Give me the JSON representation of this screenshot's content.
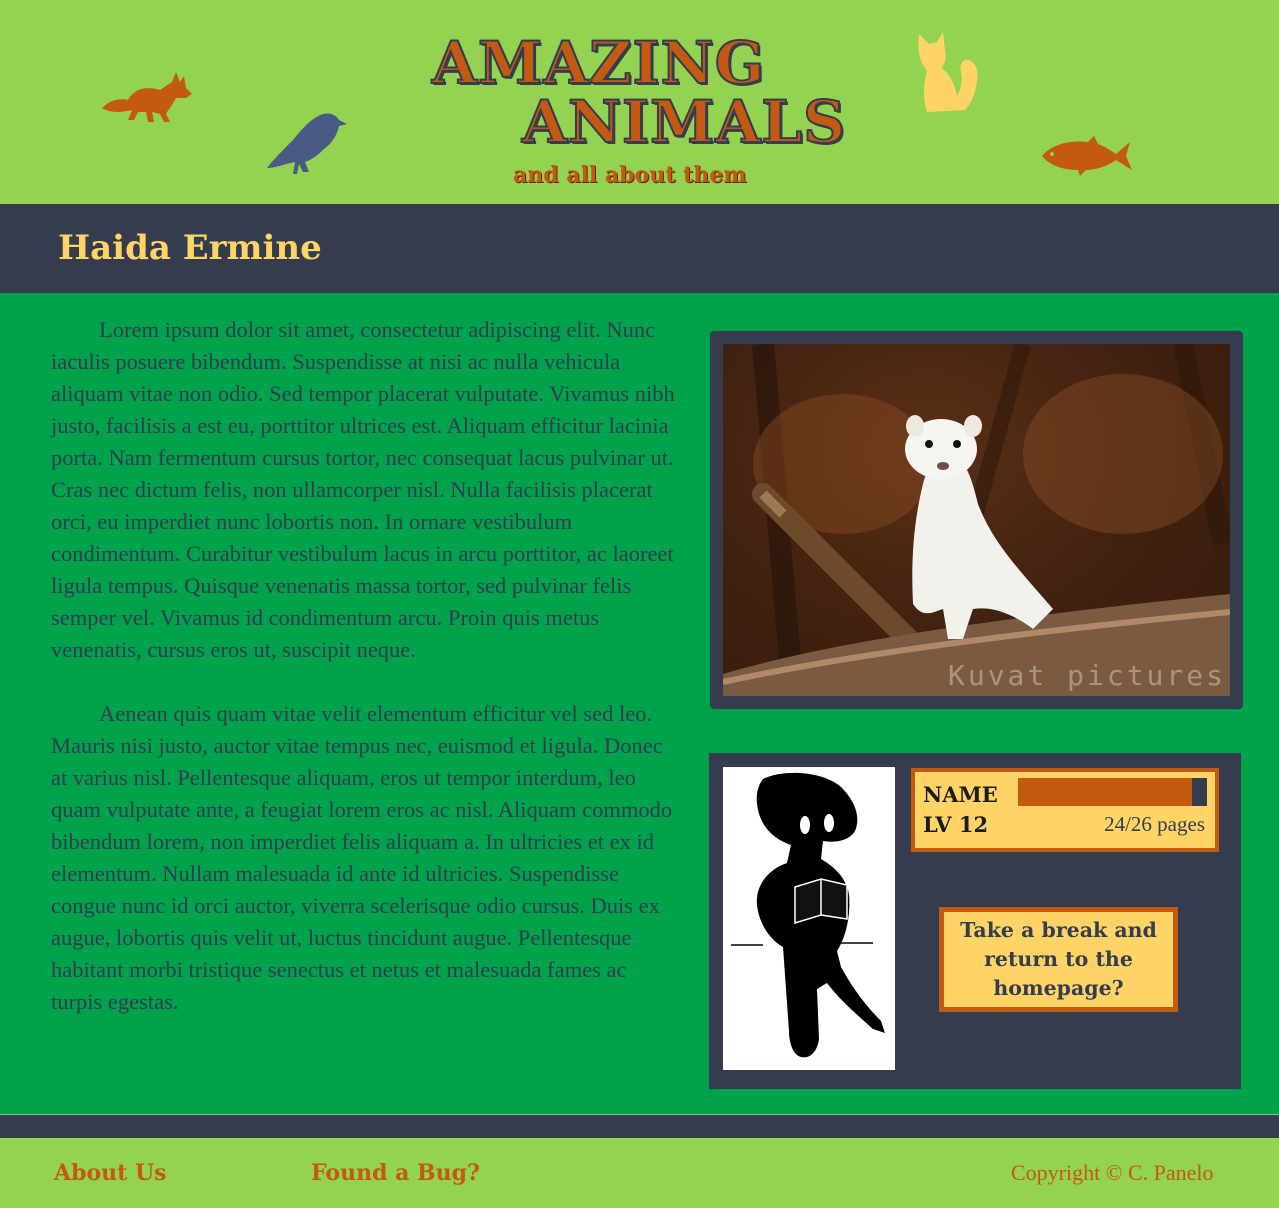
{
  "header": {
    "logo_line1": "AMAZING",
    "logo_line2": "ANIMALS",
    "tagline": "and all about them"
  },
  "icons": {
    "fox": "fox-icon",
    "bird": "bird-icon",
    "cat": "cat-icon",
    "fish": "fish-icon"
  },
  "page": {
    "title": "Haida Ermine"
  },
  "article": {
    "paragraphs": [
      "Lorem ipsum dolor sit amet, consectetur adipiscing elit. Nunc iaculis posuere bibendum. Suspendisse at nisi ac nulla vehicula aliquam vitae non odio. Sed tempor placerat vulputate. Vivamus nibh justo, facilisis a est eu, porttitor ultrices est. Aliquam efficitur lacinia porta. Nam fermentum cursus tortor, nec consequat lacus pulvinar ut. Cras nec dictum felis, non ullamcorper nisl. Nulla facilisis placerat orci, eu imperdiet nunc lobortis non. In ornare vestibulum condimentum. Curabitur vestibulum lacus in arcu porttitor, ac laoreet ligula tempus. Quisque venenatis massa tortor, sed pulvinar felis semper vel. Vivamus id condimentum arcu. Proin quis metus venenatis, cursus eros ut, suscipit neque.",
      "Aenean quis quam vitae velit elementum efficitur vel sed leo. Mauris nisi justo, auctor vitae tempus nec, euismod et ligula. Donec at varius nisl. Pellentesque aliquam, eros ut tempor interdum, leo quam vulputate ante, a feugiat lorem eros ac nisl. Aliquam commodo bibendum lorem, non imperdiet felis aliquam a. In ultricies et ex id elementum. Nullam malesuada id ante id ultricies. Suspendisse congue nunc id orci auctor, viverra scelerisque odio cursus. Duis ex augue, lobortis quis velit ut, luctus tincidunt augue. Pellentesque habitant morbi tristique senectus et netus et malesuada fames ac turpis egestas."
    ]
  },
  "photo": {
    "credit": "Kuvat pictures"
  },
  "status": {
    "name_label": "NAME",
    "level_label": "LV 12",
    "pages_read": 24,
    "pages_total": 26,
    "pages_text": "24/26 pages",
    "break_button": "Take a break and return to the homepage?"
  },
  "footer": {
    "about": "About Us",
    "bug": "Found a Bug?",
    "copyright": "Copyright © C. Panelo"
  },
  "colors": {
    "header_green": "#94d352",
    "body_green": "#00a24c",
    "navy": "#343c4e",
    "orange": "#c45a12",
    "yellow": "#ffd466"
  }
}
